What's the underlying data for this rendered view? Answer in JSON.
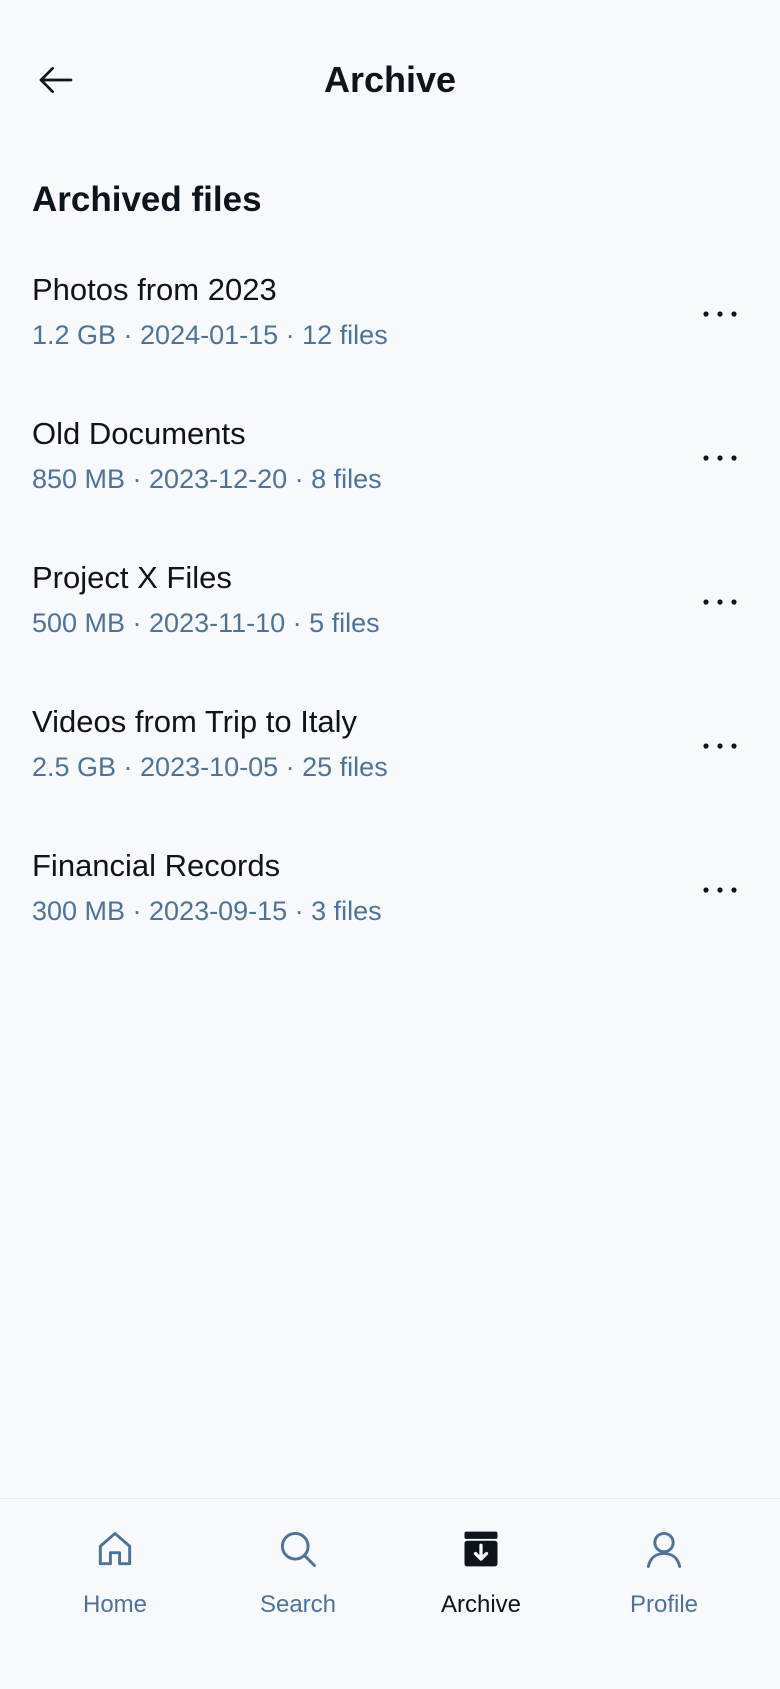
{
  "header": {
    "title": "Archive",
    "back_icon": "arrow-left-icon"
  },
  "section": {
    "title": "Archived files"
  },
  "files": [
    {
      "name": "Photos from 2023",
      "meta": "1.2 GB · 2024-01-15 · 12 files"
    },
    {
      "name": "Old Documents",
      "meta": "850 MB · 2023-12-20 · 8 files"
    },
    {
      "name": "Project X Files",
      "meta": "500 MB · 2023-11-10 · 5 files"
    },
    {
      "name": "Videos from Trip to Italy",
      "meta": "2.5 GB · 2023-10-05 · 25 files"
    },
    {
      "name": "Financial Records",
      "meta": "300 MB · 2023-09-15 · 3 files"
    }
  ],
  "bottom_nav": {
    "items": [
      {
        "label": "Home",
        "icon": "house-icon",
        "active": false
      },
      {
        "label": "Search",
        "icon": "magnifying-glass-icon",
        "active": false
      },
      {
        "label": "Archive",
        "icon": "archive-box-icon",
        "active": true
      },
      {
        "label": "Profile",
        "icon": "user-icon",
        "active": false
      }
    ]
  },
  "colors": {
    "background": "#f7f9fc",
    "text_primary": "#0e141b",
    "text_secondary": "#4e7397",
    "divider": "#e7edf3"
  }
}
